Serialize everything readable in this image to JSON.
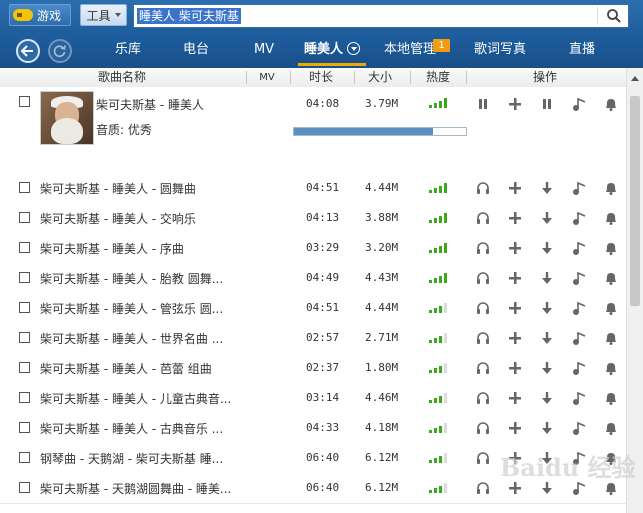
{
  "toolbar": {
    "game_label": "游戏",
    "tools_label": "工具"
  },
  "search": {
    "value": "睡美人 柴可夫斯基"
  },
  "nav": {
    "items": [
      "乐库",
      "电台",
      "MV",
      "睡美人",
      "本地管理",
      "歌词写真",
      "直播"
    ],
    "active_index": 3,
    "badge": "1"
  },
  "table_headers": {
    "name": "歌曲名称",
    "mv": "MV",
    "duration": "时长",
    "size": "大小",
    "heat": "热度",
    "ops": "操作"
  },
  "expanded": {
    "title": "柴可夫斯基 - 睡美人",
    "duration": "04:08",
    "size": "3.79M",
    "heat": 4,
    "quality_label": "音质: 优秀",
    "progress": 0.81
  },
  "rows": [
    {
      "title": "柴可夫斯基 - 睡美人 - 圆舞曲",
      "duration": "04:51",
      "size": "4.44M",
      "heat": 4
    },
    {
      "title": "柴可夫斯基 - 睡美人 - 交响乐",
      "duration": "04:13",
      "size": "3.88M",
      "heat": 4
    },
    {
      "title": "柴可夫斯基 - 睡美人 - 序曲",
      "duration": "03:29",
      "size": "3.20M",
      "heat": 4
    },
    {
      "title": "柴可夫斯基 - 睡美人 - 胎教 圆舞...",
      "duration": "04:49",
      "size": "4.43M",
      "heat": 4
    },
    {
      "title": "柴可夫斯基 - 睡美人 - 管弦乐 圆...",
      "duration": "04:51",
      "size": "4.44M",
      "heat": 3
    },
    {
      "title": "柴可夫斯基 - 睡美人 - 世界名曲 ...",
      "duration": "02:57",
      "size": "2.71M",
      "heat": 3
    },
    {
      "title": "柴可夫斯基 - 睡美人 - 芭蕾 组曲",
      "duration": "02:37",
      "size": "1.80M",
      "heat": 3
    },
    {
      "title": "柴可夫斯基 - 睡美人 - 儿童古典音...",
      "duration": "03:14",
      "size": "4.46M",
      "heat": 3
    },
    {
      "title": "柴可夫斯基 - 睡美人 - 古典音乐 ...",
      "duration": "04:33",
      "size": "4.18M",
      "heat": 3
    },
    {
      "title": "钢琴曲 - 天鹅湖 - 柴可夫斯基 睡...",
      "duration": "06:40",
      "size": "6.12M",
      "heat": 3
    },
    {
      "title": "柴可夫斯基 - 天鹅湖圆舞曲 - 睡美...",
      "duration": "06:40",
      "size": "6.12M",
      "heat": 3
    }
  ],
  "watermark": "Baidu 经验",
  "colors": {
    "topbar": "#2b6fb0",
    "navbar": "#1e5e9f",
    "accent": "#f3a800",
    "heat_on": "#3aaa1c",
    "progress": "#5b8fc4"
  },
  "icons": [
    "gamepad-icon",
    "search-icon",
    "back-icon",
    "refresh-icon",
    "chevron-down-icon",
    "pause-icon",
    "headphones-icon",
    "add-icon",
    "download-icon",
    "mv-icon",
    "bell-icon"
  ]
}
